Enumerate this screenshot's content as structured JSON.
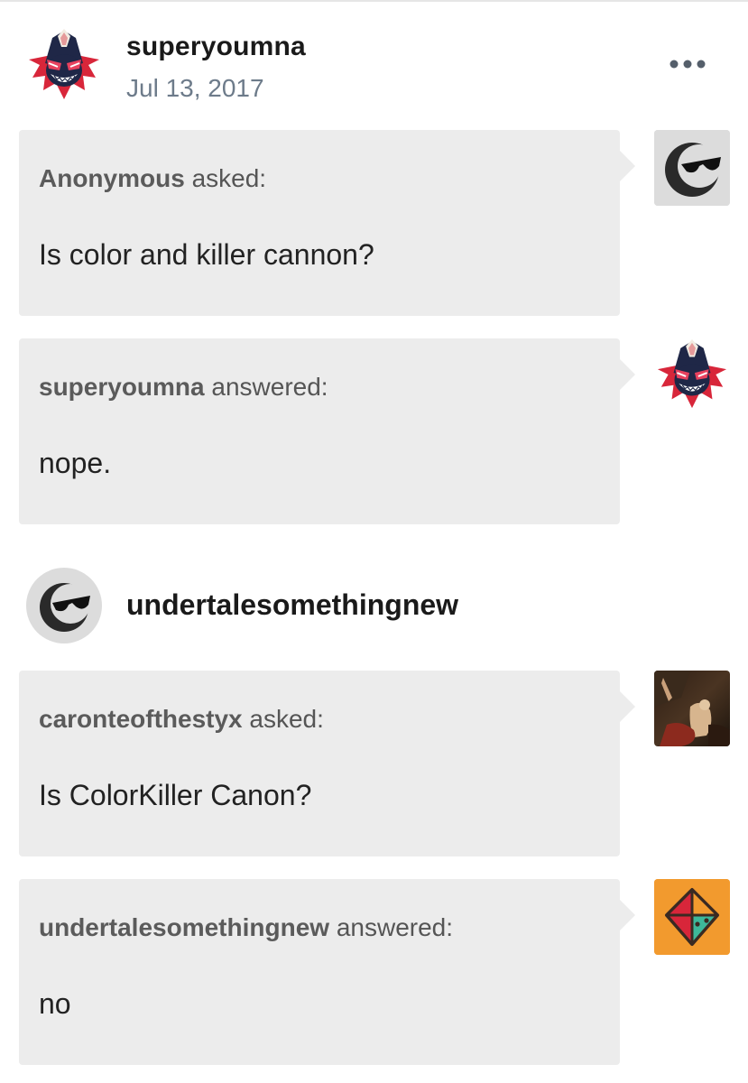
{
  "post": {
    "author": "superyoumna",
    "date": "Jul 13, 2017",
    "more_icon": "ellipsis-icon"
  },
  "thread": [
    {
      "kind": "ask",
      "who": "Anonymous",
      "verb": "asked:",
      "text": "Is color and killer cannon?",
      "avatar": "sunglasses-moon-avatar"
    },
    {
      "kind": "answer",
      "who": "superyoumna",
      "verb": "answered:",
      "text": "nope.",
      "avatar": "grinning-mask-avatar"
    }
  ],
  "reblog": {
    "author": "undertalesomethingnew"
  },
  "thread2": [
    {
      "kind": "ask",
      "who": "caronteofthestyx",
      "verb": "asked:",
      "text": "Is ColorKiller Canon?",
      "avatar": "painting-avatar"
    },
    {
      "kind": "answer",
      "who": "undertalesomethingnew",
      "verb": "answered:",
      "text": "no",
      "avatar": "diamond-face-avatar"
    }
  ],
  "colors": {
    "bubble_bg": "#ececec",
    "date_text": "#6d7b8a",
    "accent_orange": "#f29a2e",
    "mask_red": "#d8263a",
    "mask_navy": "#1f2747"
  }
}
